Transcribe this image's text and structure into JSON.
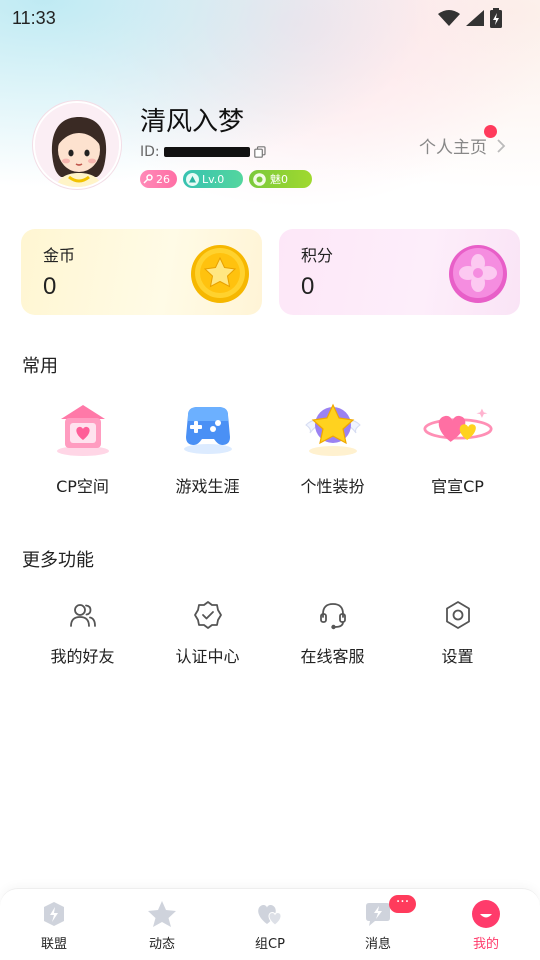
{
  "status_bar": {
    "time": "11:33"
  },
  "profile": {
    "name": "清风入梦",
    "id_label": "ID:",
    "badges": {
      "likes": "26",
      "level": "Lv.0",
      "charm": "魅0"
    },
    "homepage_label": "个人主页",
    "homepage_has_notification": true
  },
  "wallet": {
    "coins": {
      "label": "金币",
      "value": "0"
    },
    "points": {
      "label": "积分",
      "value": "0"
    }
  },
  "common": {
    "title": "常用",
    "items": [
      {
        "label": "CP空间",
        "icon": "pink-house-icon"
      },
      {
        "label": "游戏生涯",
        "icon": "gamepad-icon"
      },
      {
        "label": "个性装扮",
        "icon": "winged-star-icon"
      },
      {
        "label": "官宣CP",
        "icon": "hearts-ring-icon"
      }
    ]
  },
  "more": {
    "title": "更多功能",
    "items": [
      {
        "label": "我的好友",
        "icon": "friends-icon"
      },
      {
        "label": "认证中心",
        "icon": "verified-badge-icon"
      },
      {
        "label": "在线客服",
        "icon": "headset-icon"
      },
      {
        "label": "设置",
        "icon": "settings-hexagon-icon"
      }
    ]
  },
  "tabbar": {
    "items": [
      {
        "label": "联盟",
        "icon": "alliance-icon"
      },
      {
        "label": "动态",
        "icon": "star-icon"
      },
      {
        "label": "组CP",
        "icon": "hearts-icon"
      },
      {
        "label": "消息",
        "icon": "message-icon",
        "badge": "···"
      },
      {
        "label": "我的",
        "icon": "me-icon",
        "active": true
      }
    ]
  },
  "colors": {
    "accent": "#ff3b6b",
    "notification": "#ff3b5c"
  }
}
